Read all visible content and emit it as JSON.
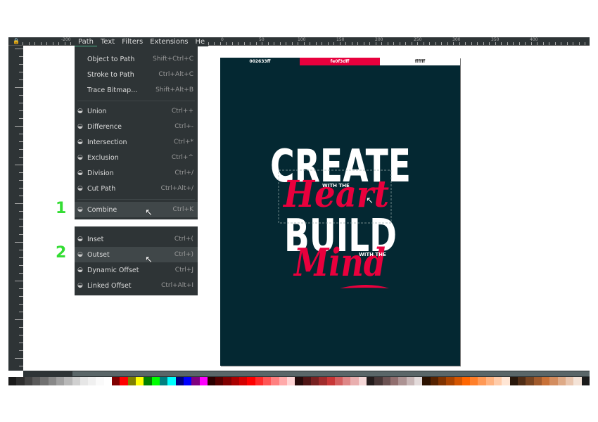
{
  "ruler": {
    "top_labels": [
      "-200",
      "0",
      "50",
      "100",
      "150",
      "200",
      "250",
      "300",
      "350",
      "400"
    ]
  },
  "menubar": {
    "items": [
      "Path",
      "Text",
      "Filters",
      "Extensions",
      "He"
    ]
  },
  "path_menu": {
    "items": [
      {
        "label": "Object to Path",
        "shortcut": "Shift+Ctrl+C",
        "icon": ""
      },
      {
        "label": "Stroke to Path",
        "shortcut": "Ctrl+Alt+C",
        "icon": ""
      },
      {
        "label": "Trace Bitmap...",
        "shortcut": "Shift+Alt+B",
        "icon": ""
      },
      {
        "label": "Union",
        "shortcut": "Ctrl++",
        "icon": "union-icon"
      },
      {
        "label": "Difference",
        "shortcut": "Ctrl+-",
        "icon": "difference-icon"
      },
      {
        "label": "Intersection",
        "shortcut": "Ctrl+*",
        "icon": "intersection-icon"
      },
      {
        "label": "Exclusion",
        "shortcut": "Ctrl+^",
        "icon": "exclusion-icon"
      },
      {
        "label": "Division",
        "shortcut": "Ctrl+/",
        "icon": "division-icon"
      },
      {
        "label": "Cut Path",
        "shortcut": "Ctrl+Alt+/",
        "icon": "cut-path-icon"
      },
      {
        "label": "Combine",
        "shortcut": "Ctrl+K",
        "icon": "combine-icon"
      }
    ]
  },
  "offset_menu": {
    "items": [
      {
        "label": "Inset",
        "shortcut": "Ctrl+(",
        "icon": "inset-icon"
      },
      {
        "label": "Outset",
        "shortcut": "Ctrl+)",
        "icon": "outset-icon"
      },
      {
        "label": "Dynamic Offset",
        "shortcut": "Ctrl+J",
        "icon": "dynamic-offset-icon"
      },
      {
        "label": "Linked Offset",
        "shortcut": "Ctrl+Alt+I",
        "icon": "linked-offset-icon"
      }
    ]
  },
  "steps": [
    "1",
    "2"
  ],
  "poster": {
    "swatches": [
      {
        "label": "002633ff",
        "color": "#002633"
      },
      {
        "label": "fe0f3dff",
        "color": "#e8003d"
      },
      {
        "label": "ffffff",
        "color": "#ffffff"
      }
    ],
    "line1": "CREATE",
    "small1": "WITH THE",
    "script1": "Heart",
    "line2": "BUILD",
    "small2": "WITH THE",
    "script2": "Mind"
  },
  "colors": {
    "accent": "#e8003d",
    "background": "#042832",
    "step_label": "#33dd33",
    "menu_bg": "#2e3436"
  },
  "palette": [
    "#1a1a1a",
    "#2e2e2e",
    "#444",
    "#5a5a5a",
    "#707070",
    "#888",
    "#a0a0a0",
    "#b8b8b8",
    "#d0d0d0",
    "#e6e6e6",
    "#f0f0f0",
    "#fafafa",
    "#fff",
    "#800000",
    "#ff0000",
    "#808000",
    "#ffff00",
    "#008000",
    "#00ff00",
    "#008080",
    "#00ffff",
    "#000080",
    "#0000ff",
    "#800080",
    "#ff00ff",
    "#2b0000",
    "#550000",
    "#800000",
    "#aa0000",
    "#d40000",
    "#ff0000",
    "#ff2a2a",
    "#ff5555",
    "#ff8080",
    "#ffaaaa",
    "#ffd5d5",
    "#280b0b",
    "#501616",
    "#782121",
    "#a02c2c",
    "#c83737",
    "#d35f5f",
    "#de8787",
    "#e9afaf",
    "#f4d7d7",
    "#241c1c",
    "#483737",
    "#6c5353",
    "#916f6f",
    "#ac9393",
    "#c8b7b7",
    "#e3dbdb",
    "#2b1100",
    "#552200",
    "#803300",
    "#aa4400",
    "#d45500",
    "#ff6600",
    "#ff7f2a",
    "#ff9955",
    "#ffb380",
    "#ffccaa",
    "#ffe6d5",
    "#28170b",
    "#502d16",
    "#784421",
    "#a05a2c",
    "#c87137",
    "#d38d5f",
    "#deaa87",
    "#e9c6af",
    "#f4e3d7",
    "#1a1a1a"
  ]
}
